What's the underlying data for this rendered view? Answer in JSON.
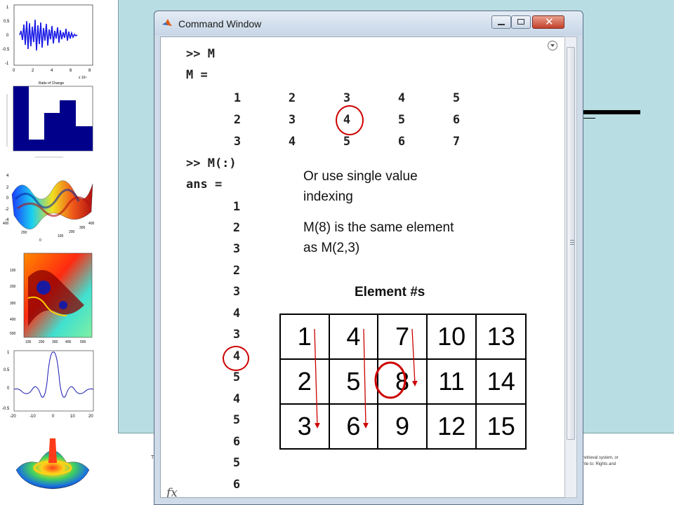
{
  "window": {
    "title": "Command Window"
  },
  "console": {
    "prompt1": ">> M",
    "var_header": "M =",
    "matrix_rows": [
      [
        "1",
        "2",
        "3",
        "4",
        "5"
      ],
      [
        "2",
        "3",
        "4",
        "5",
        "6"
      ],
      [
        "3",
        "4",
        "5",
        "6",
        "7"
      ]
    ],
    "prompt2": ">> M(:)",
    "ans_header": "ans =",
    "ans_values": [
      "1",
      "2",
      "3",
      "2",
      "3",
      "4",
      "3",
      "4",
      "5",
      "4",
      "5",
      "6",
      "5",
      "6"
    ],
    "fx_label": "fx"
  },
  "overlay": {
    "note1": "Or use single value indexing",
    "note2": "M(8) is the same element as M(2,3)",
    "element_title": "Element #s",
    "element_grid": [
      [
        "1",
        "4",
        "7",
        "10",
        "13"
      ],
      [
        "2",
        "5",
        "8",
        "11",
        "14"
      ],
      [
        "3",
        "6",
        "9",
        "12",
        "15"
      ]
    ]
  },
  "slide": {
    "footer_right_line1": "retrieval system, or",
    "footer_right_line2": "nte to: Rights and",
    "footer_left": "T"
  },
  "thumbnails": {
    "waveform": {
      "y_ticks": [
        "1",
        "0.5",
        "0",
        "-0.5",
        "-1"
      ],
      "x_ticks": [
        "0",
        "2",
        "4",
        "6",
        "8"
      ],
      "x_exp": "x 10⁴"
    },
    "bar": {
      "title": "Ratio of Change"
    },
    "surface": {
      "y_ticks": [
        "4",
        "2",
        "0",
        "-2",
        "-4"
      ],
      "x_ticks": [
        "400",
        "200",
        "0"
      ],
      "x_ticks2": [
        "100",
        "200",
        "300",
        "400"
      ]
    },
    "fractal": {
      "y_ticks": [
        "100",
        "200",
        "300",
        "400",
        "500"
      ],
      "x_ticks": [
        "100",
        "200",
        "300",
        "400",
        "500"
      ]
    },
    "sinc": {
      "y_ticks": [
        "1",
        "0.5",
        "0",
        "-0.5"
      ],
      "x_ticks": [
        "-20",
        "-10",
        "0",
        "10",
        "20"
      ]
    }
  },
  "colors": {
    "slide_bg": "#b8dde2",
    "circle": "#cc0000",
    "arrow": "#cc0000"
  }
}
